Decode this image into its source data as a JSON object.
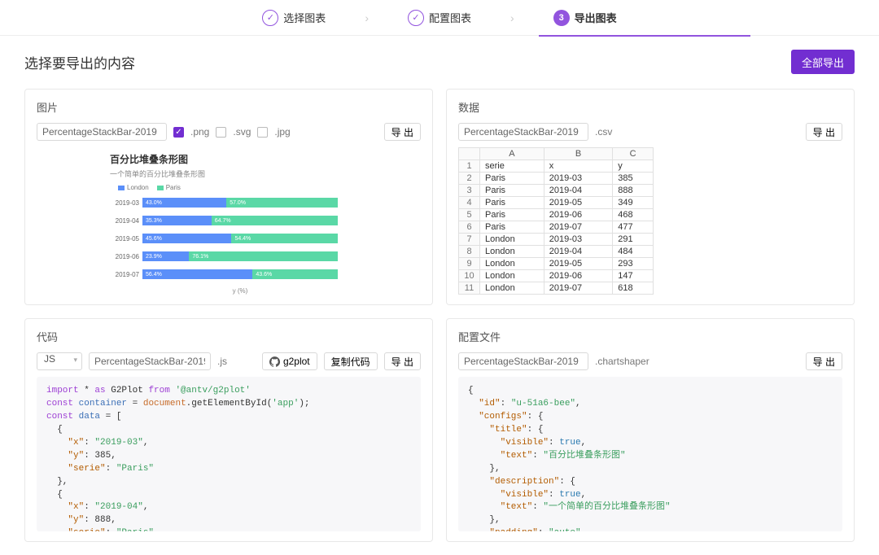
{
  "steps": {
    "s1": "选择图表",
    "s2": "配置图表",
    "s3": "导出图表",
    "active_idx": "3"
  },
  "page_title": "选择要导出的内容",
  "export_all": "全部导出",
  "export_btn": "导 出",
  "copy_code": "复制代码",
  "gh_label": "g2plot",
  "filename": "PercentageStackBar-2019",
  "panels": {
    "image": "图片",
    "data": "数据",
    "code": "代码",
    "config": "配置文件"
  },
  "formats": {
    "png": ".png",
    "svg": ".svg",
    "jpg": ".jpg",
    "csv": ".csv",
    "js": ".js",
    "cs": ".chartshaper"
  },
  "lang_select": "JS",
  "chart_data": {
    "type": "bar",
    "stacked_percent": true,
    "title": "百分比堆叠条形图",
    "subtitle": "一个简单的百分比堆叠条形图",
    "ylabel": "y (%)",
    "categories": [
      "2019-03",
      "2019-04",
      "2019-05",
      "2019-06",
      "2019-07"
    ],
    "series": [
      {
        "name": "London",
        "color": "#5b8ff9",
        "values": [
          43.0,
          35.3,
          45.6,
          23.9,
          56.4
        ]
      },
      {
        "name": "Paris",
        "color": "#5ad8a6",
        "values": [
          57.0,
          64.7,
          54.4,
          76.1,
          43.6
        ]
      }
    ],
    "raw_table": {
      "header": [
        "A",
        "B",
        "C"
      ],
      "cols": [
        "serie",
        "x",
        "y"
      ],
      "rows": [
        [
          "Paris",
          "2019-03",
          "385"
        ],
        [
          "Paris",
          "2019-04",
          "888"
        ],
        [
          "Paris",
          "2019-05",
          "349"
        ],
        [
          "Paris",
          "2019-06",
          "468"
        ],
        [
          "Paris",
          "2019-07",
          "477"
        ],
        [
          "London",
          "2019-03",
          "291"
        ],
        [
          "London",
          "2019-04",
          "484"
        ],
        [
          "London",
          "2019-05",
          "293"
        ],
        [
          "London",
          "2019-06",
          "147"
        ],
        [
          "London",
          "2019-07",
          "618"
        ]
      ]
    }
  },
  "code_snippet": {
    "lib": "'@antv/g2plot'",
    "app_id": "'app'",
    "rows": [
      {
        "x": "2019-03",
        "y": 385,
        "serie": "Paris"
      },
      {
        "x": "2019-04",
        "y": 888,
        "serie": "Paris"
      }
    ]
  },
  "config_snippet": {
    "id": "u-51a6-bee",
    "title_text": "百分比堆叠条形图",
    "desc_text": "一个简单的百分比堆叠条形图",
    "padding": "auto"
  }
}
